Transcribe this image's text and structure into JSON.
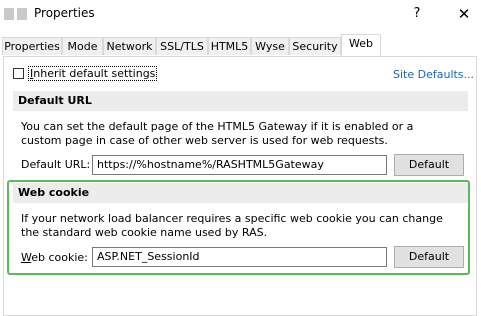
{
  "window": {
    "title": "Properties",
    "help_label": "?",
    "close_label": "✕"
  },
  "tabs": [
    {
      "label": "Properties"
    },
    {
      "label": "Mode"
    },
    {
      "label": "Network"
    },
    {
      "label": "SSL/TLS"
    },
    {
      "label": "HTML5"
    },
    {
      "label": "Wyse"
    },
    {
      "label": "Security"
    },
    {
      "label": "Web",
      "active": true
    }
  ],
  "inherit": {
    "label_accel": "I",
    "label_rest": "nherit default settings",
    "checked": false
  },
  "site_defaults_link": "Site Defaults...",
  "default_url": {
    "header": "Default URL",
    "description": "You can set the default page of the HTML5 Gateway if it is enabled or a custom page in case of other web server is used for web requests.",
    "field_label": "Default URL:",
    "value": "https://%hostname%/RASHTML5Gateway",
    "button_label": "Default"
  },
  "web_cookie": {
    "header": "Web cookie",
    "description": "If your network load balancer requires a specific web cookie you can change the standard web cookie name used by RAS.",
    "field_label_accel": "W",
    "field_label_rest": "eb cookie:",
    "value": "ASP.NET_SessionId",
    "button_label": "Default"
  },
  "colors": {
    "highlight": "#5cb85c",
    "link": "#1a64b8",
    "section_header_bg": "#ececec"
  }
}
